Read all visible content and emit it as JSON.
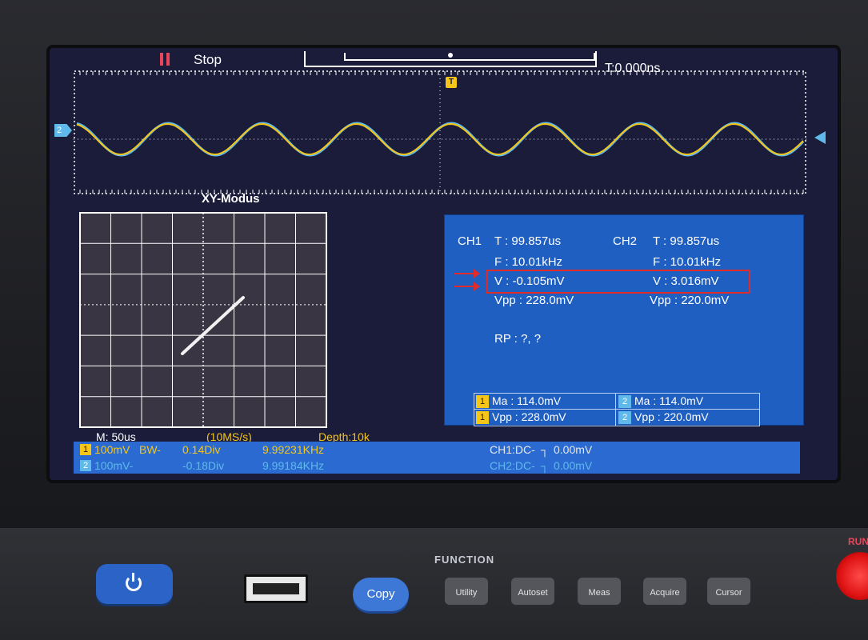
{
  "status": {
    "run_state": "Stop",
    "trigger_time": "T:0.000ns"
  },
  "xy_view": {
    "title": "XY-Modus"
  },
  "measurements": {
    "ch1_label": "CH1",
    "ch2_label": "CH2",
    "ch1": {
      "period": "T : 99.857us",
      "freq": "F : 10.01kHz",
      "mean": "V : -0.105mV",
      "vpp": "Vpp : 228.0mV"
    },
    "ch2": {
      "period": "T : 99.857us",
      "freq": "F : 10.01kHz",
      "mean": "V : 3.016mV",
      "vpp": "Vpp : 220.0mV"
    },
    "rp": "RP :   ?,    ?",
    "cursor_table": {
      "ch1_ma": "Ma : 114.0mV",
      "ch2_ma": "Ma : 114.0mV",
      "ch1_vpp": "Vpp : 228.0mV",
      "ch2_vpp": "Vpp : 220.0mV",
      "ch1_num": "1",
      "ch2_num": "2"
    }
  },
  "timebase": {
    "main": "M: 50us",
    "sample_rate": "(10MS/s)",
    "depth": "Depth:10k"
  },
  "channels": [
    {
      "num": "1",
      "scale": "100mV",
      "bw": "BW-",
      "offset": "0.14Div",
      "freq": "9.99231KHz",
      "coupling": "CH1:DC-",
      "trig_level": "0.00mV",
      "color": "#f5c518"
    },
    {
      "num": "2",
      "scale": "100mV-",
      "bw": "",
      "offset": "-0.18Div",
      "freq": "9.99184KHz",
      "coupling": "CH2:DC-",
      "trig_level": "0.00mV",
      "color": "#5fb9ea"
    }
  ],
  "trigger_marker": "T",
  "ch2_marker": "2",
  "front_panel": {
    "copy": "Copy",
    "function": "FUNCTION",
    "buttons": [
      "Utility",
      "Autoset",
      "Meas",
      "Acquire",
      "Cursor"
    ],
    "run_label": "RUN"
  },
  "icons": {
    "power": "power-icon",
    "usb": "usb-port-icon",
    "pause": "pause-icon"
  },
  "colors": {
    "ch1": "#f5c518",
    "ch2": "#5fb9ea",
    "highlight": "#e02b2b",
    "panel": "#1f5fc2"
  }
}
